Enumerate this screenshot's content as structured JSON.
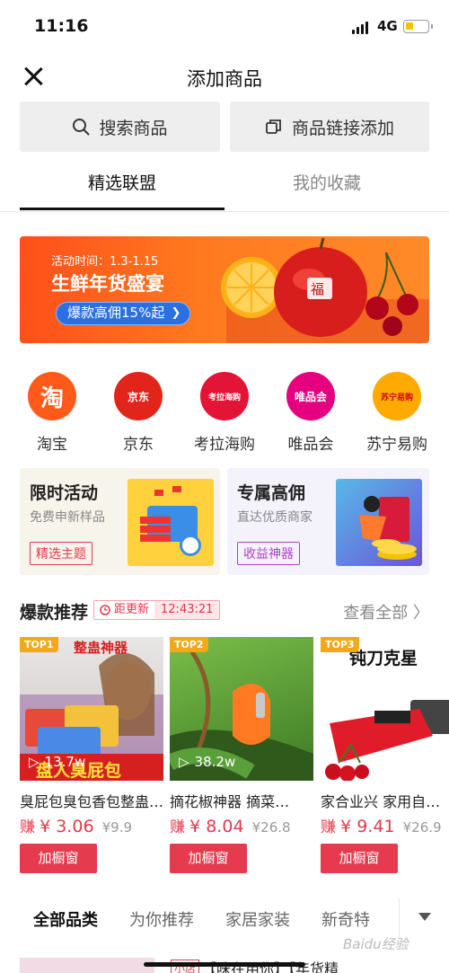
{
  "status": {
    "time": "11:16",
    "network": "4G"
  },
  "nav": {
    "title": "添加商品"
  },
  "actions": {
    "search_label": "搜索商品",
    "link_label": "商品链接添加"
  },
  "tabs": [
    {
      "label": "精选联盟",
      "active": true
    },
    {
      "label": "我的收藏",
      "active": false
    }
  ],
  "banner": {
    "date": "活动时间：1.3-1.15",
    "title": "生鲜年货盛宴",
    "cta": "爆款高佣15%起"
  },
  "platforms": [
    {
      "label": "淘宝",
      "icon": "淘",
      "color": "#ff5000"
    },
    {
      "label": "京东",
      "icon": "京东",
      "color": "#e1251b"
    },
    {
      "label": "考拉海购",
      "icon": "考拉海购",
      "color": "#e31436"
    },
    {
      "label": "唯品会",
      "icon": "唯品会",
      "color": "#e4007f"
    },
    {
      "label": "苏宁易购",
      "icon": "苏宁易购",
      "color": "#ffaa00"
    }
  ],
  "promos": [
    {
      "title": "限时活动",
      "subtitle": "免费申新样品",
      "tag": "精选主题"
    },
    {
      "title": "专属高佣",
      "subtitle": "直达优质商家",
      "tag": "收益神器"
    }
  ],
  "hot": {
    "title": "爆款推荐",
    "update_label": "距更新",
    "countdown": "12:43:21",
    "see_all": "查看全部 〉",
    "products": [
      {
        "rank": "TOP1",
        "views": "13.7w",
        "name": "臭屁包臭包香包整蛊…",
        "earn": "赚",
        "amount": "¥ 3.06",
        "original": "¥9.9",
        "button": "加橱窗",
        "overlay_top": "整蛊神器",
        "overlay_bottom": "盘人臭屁包"
      },
      {
        "rank": "TOP2",
        "views": "38.2w",
        "name": "摘花椒神器 摘菜…",
        "earn": "赚",
        "amount": "¥ 8.04",
        "original": "¥26.8",
        "button": "加橱窗"
      },
      {
        "rank": "TOP3",
        "views": "",
        "name": "家合业兴 家用自…",
        "earn": "赚",
        "amount": "¥ 9.41",
        "original": "¥26.9",
        "button": "加橱窗",
        "overlay_top": "钝刀克星"
      }
    ]
  },
  "categories": [
    {
      "label": "全部品类",
      "active": true
    },
    {
      "label": "为你推荐",
      "active": false
    },
    {
      "label": "家居家装",
      "active": false
    },
    {
      "label": "新奇特",
      "active": false
    }
  ],
  "bottom_item": {
    "tag": "小店",
    "title": "【味在用你】【年货精"
  },
  "watermark": "Baidu经验"
}
